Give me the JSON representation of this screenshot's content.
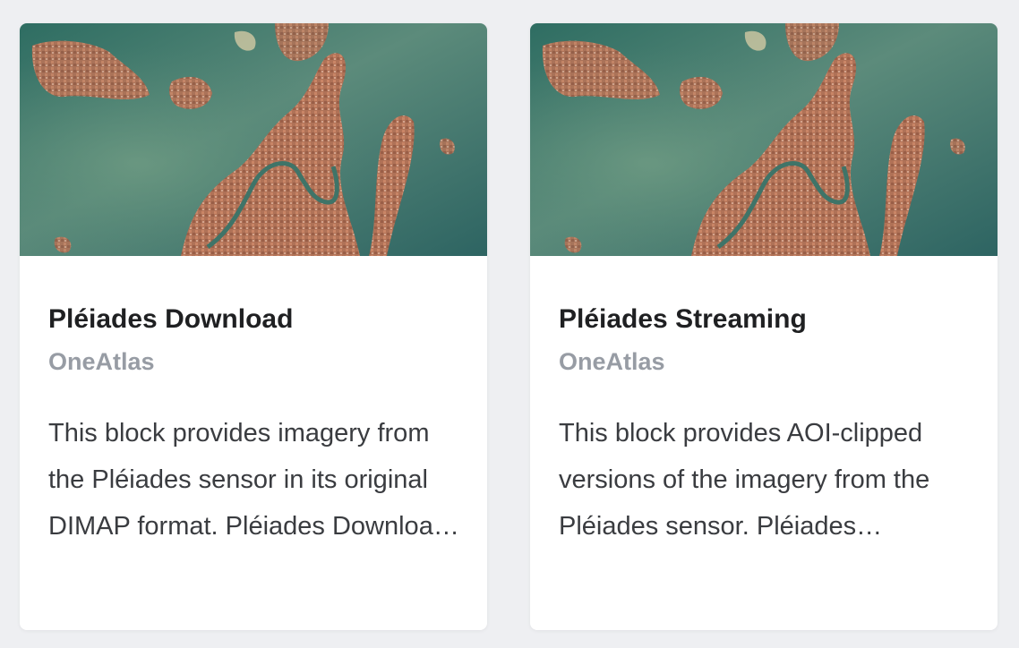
{
  "cards": [
    {
      "title": "Pléiades Download",
      "provider": "OneAtlas",
      "description": "This block provides imagery from the Pléiades sensor in its original DIMAP format. Pléiades Download gives access to full-resolution data for analytics workflows."
    },
    {
      "title": "Pléiades Streaming",
      "provider": "OneAtlas",
      "description": "This block provides AOI-clipped versions of the imagery from the Pléiades sensor. Pléiades Streaming delivers web-ready tiles for visualization."
    }
  ],
  "colors": {
    "background": "#eeeff2",
    "card": "#ffffff",
    "title": "#1f2022",
    "provider": "#979ca4",
    "description": "#3a3c40",
    "water": "#3f7a6c",
    "land": "#b0765a"
  }
}
